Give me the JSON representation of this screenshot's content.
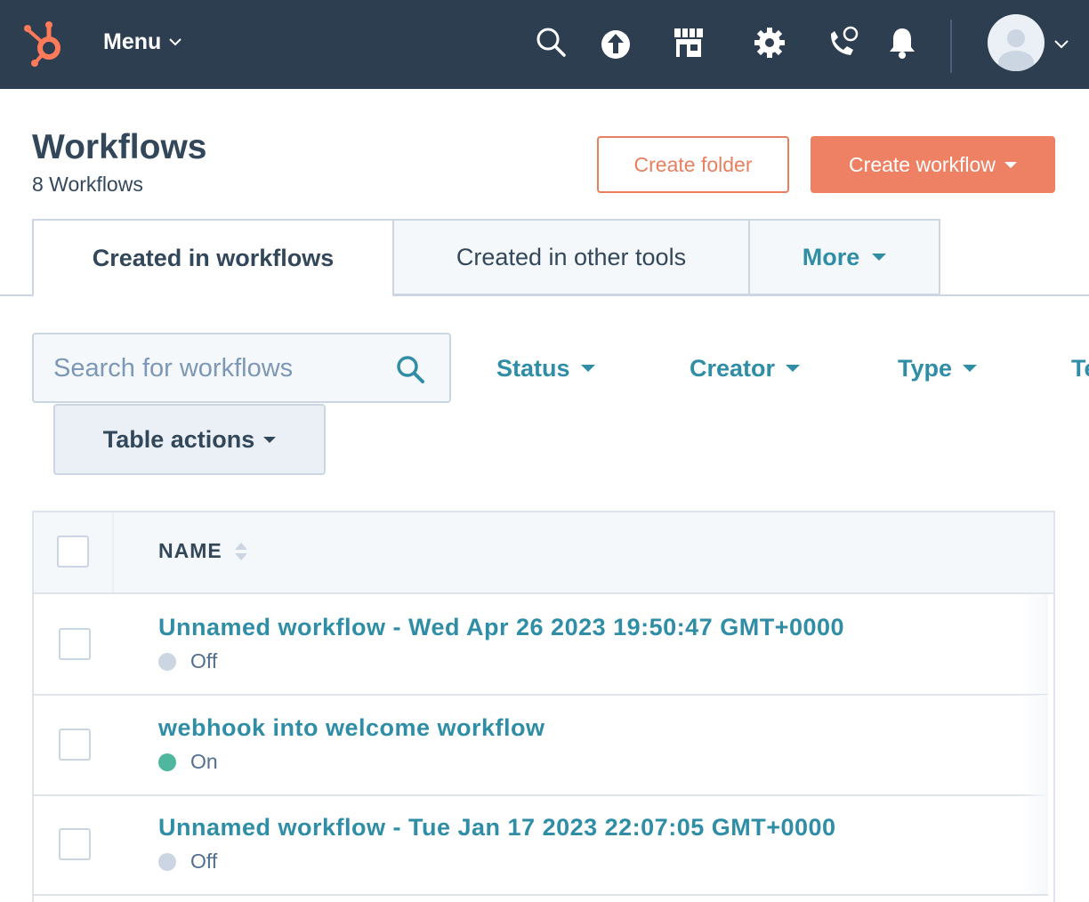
{
  "nav": {
    "menu_label": "Menu",
    "icons": [
      "hubspot-logo",
      "search-icon",
      "upgrade-icon",
      "marketplace-icon",
      "settings-icon",
      "calling-icon",
      "notifications-icon",
      "avatar"
    ]
  },
  "header": {
    "title": "Workflows",
    "count": "8 Workflows",
    "create_folder": "Create folder",
    "create_workflow": "Create workflow"
  },
  "tabs": [
    {
      "label": "Created in workflows",
      "active": true
    },
    {
      "label": "Created in other tools",
      "active": false
    },
    {
      "label": "More",
      "active": false
    }
  ],
  "search": {
    "placeholder": "Search for workflows"
  },
  "filters": [
    "Status",
    "Creator",
    "Type",
    "Te"
  ],
  "table_actions": "Table actions",
  "table": {
    "column_name": "NAME",
    "rows": [
      {
        "name": "Unnamed workflow - Wed Apr 26 2023 19:50:47 GMT+0000",
        "status": "Off",
        "status_color": "#cbd6e2"
      },
      {
        "name": "webhook into welcome workflow",
        "status": "On",
        "status_color": "#4fb79e"
      },
      {
        "name": "Unnamed workflow - Tue Jan 17 2023 22:07:05 GMT+0000",
        "status": "Off",
        "status_color": "#cbd6e2"
      }
    ]
  },
  "colors": {
    "nav_bg": "#2d3e50",
    "accent": "#ee8064",
    "link": "#2f8ea6",
    "text": "#33475b"
  }
}
